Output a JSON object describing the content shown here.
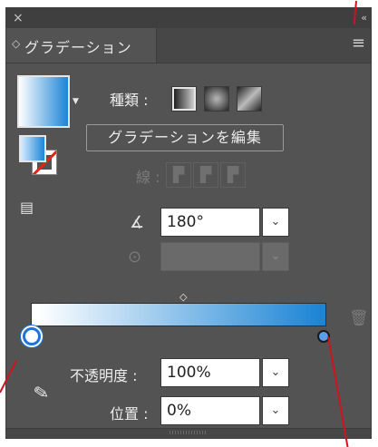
{
  "titlebar": {
    "close_glyph": "×",
    "collapse_glyph": "‹‹"
  },
  "tab": {
    "icon": "◇",
    "label": "グラデーション",
    "menu_glyph": "≡"
  },
  "swatch": {
    "arrow_glyph": "▼"
  },
  "type": {
    "label": "種類 :"
  },
  "edit_button": {
    "label": "グラデーションを編集"
  },
  "stroke": {
    "label": "線 :"
  },
  "angle": {
    "value": "180°",
    "icon": "angle-icon"
  },
  "opacity": {
    "label": "不透明度 :",
    "value": "100%"
  },
  "position": {
    "label": "位置 :",
    "value": "0%"
  },
  "gradient": {
    "start_color": "#ffffff",
    "end_color": "#1d85d6"
  },
  "colors": {
    "panel_bg": "#535353",
    "accent": "#1e73d8",
    "annotation_red": "#d0141e"
  }
}
